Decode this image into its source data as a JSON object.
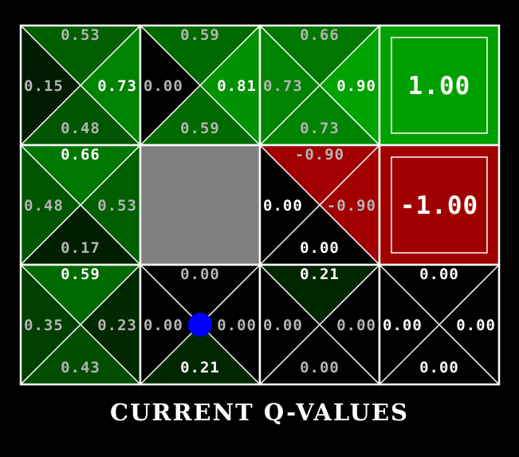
{
  "caption": "CURRENT Q-VALUES",
  "colors": {
    "background": "#000000",
    "grid_lines": "#ffffff",
    "wall": "#808080",
    "goal": "#00a000",
    "pit": "#a00000",
    "agent": "#0000ff"
  },
  "grid": {
    "rows": 3,
    "cols": 4,
    "cells": [
      {
        "row": 0,
        "col": 0,
        "type": "state",
        "north": {
          "label": "0.53",
          "q": 0.53
        },
        "west": {
          "label": "0.15",
          "q": 0.15
        },
        "east": {
          "label": "0.73",
          "q": 0.73
        },
        "south": {
          "label": "0.48",
          "q": 0.48
        }
      },
      {
        "row": 0,
        "col": 1,
        "type": "state",
        "north": {
          "label": "0.59",
          "q": 0.59
        },
        "west": {
          "label": "0.00",
          "q": 0.0
        },
        "east": {
          "label": "0.81",
          "q": 0.81
        },
        "south": {
          "label": "0.59",
          "q": 0.59
        }
      },
      {
        "row": 0,
        "col": 2,
        "type": "state",
        "north": {
          "label": "0.66",
          "q": 0.66
        },
        "west": {
          "label": "0.73",
          "q": 0.73
        },
        "east": {
          "label": "0.90",
          "q": 0.9
        },
        "south": {
          "label": "0.73",
          "q": 0.73
        }
      },
      {
        "row": 0,
        "col": 3,
        "type": "goal",
        "label": "1.00"
      },
      {
        "row": 1,
        "col": 0,
        "type": "state",
        "north": {
          "label": "0.66",
          "q": 0.66
        },
        "west": {
          "label": "0.48",
          "q": 0.48
        },
        "east": {
          "label": "0.53",
          "q": 0.53
        },
        "south": {
          "label": "0.17",
          "q": 0.17
        }
      },
      {
        "row": 1,
        "col": 1,
        "type": "wall"
      },
      {
        "row": 1,
        "col": 2,
        "type": "state",
        "north": {
          "label": "-0.90",
          "q": -0.9
        },
        "west": {
          "label": "0.00",
          "q": 0.0
        },
        "east": {
          "label": "-0.90",
          "q": -0.9
        },
        "south": {
          "label": "0.00",
          "q": 0.0
        }
      },
      {
        "row": 1,
        "col": 3,
        "type": "pit",
        "label": "-1.00"
      },
      {
        "row": 2,
        "col": 0,
        "type": "state",
        "north": {
          "label": "0.59",
          "q": 0.59
        },
        "west": {
          "label": "0.35",
          "q": 0.35
        },
        "east": {
          "label": "0.23",
          "q": 0.23
        },
        "south": {
          "label": "0.43",
          "q": 0.43
        }
      },
      {
        "row": 2,
        "col": 1,
        "type": "state",
        "agent": true,
        "north": {
          "label": "0.00",
          "q": 0.0
        },
        "west": {
          "label": "0.00",
          "q": 0.0
        },
        "east": {
          "label": "0.00",
          "q": 0.0
        },
        "south": {
          "label": "0.21",
          "q": 0.21
        }
      },
      {
        "row": 2,
        "col": 2,
        "type": "state",
        "north": {
          "label": "0.21",
          "q": 0.21
        },
        "west": {
          "label": "0.00",
          "q": 0.0
        },
        "east": {
          "label": "0.00",
          "q": 0.0
        },
        "south": {
          "label": "0.00",
          "q": 0.0
        }
      },
      {
        "row": 2,
        "col": 3,
        "type": "state",
        "north": {
          "label": "0.00",
          "q": 0.0
        },
        "west": {
          "label": "0.00",
          "q": 0.0
        },
        "east": {
          "label": "0.00",
          "q": 0.0
        },
        "south": {
          "label": "0.00",
          "q": 0.0
        }
      }
    ]
  }
}
